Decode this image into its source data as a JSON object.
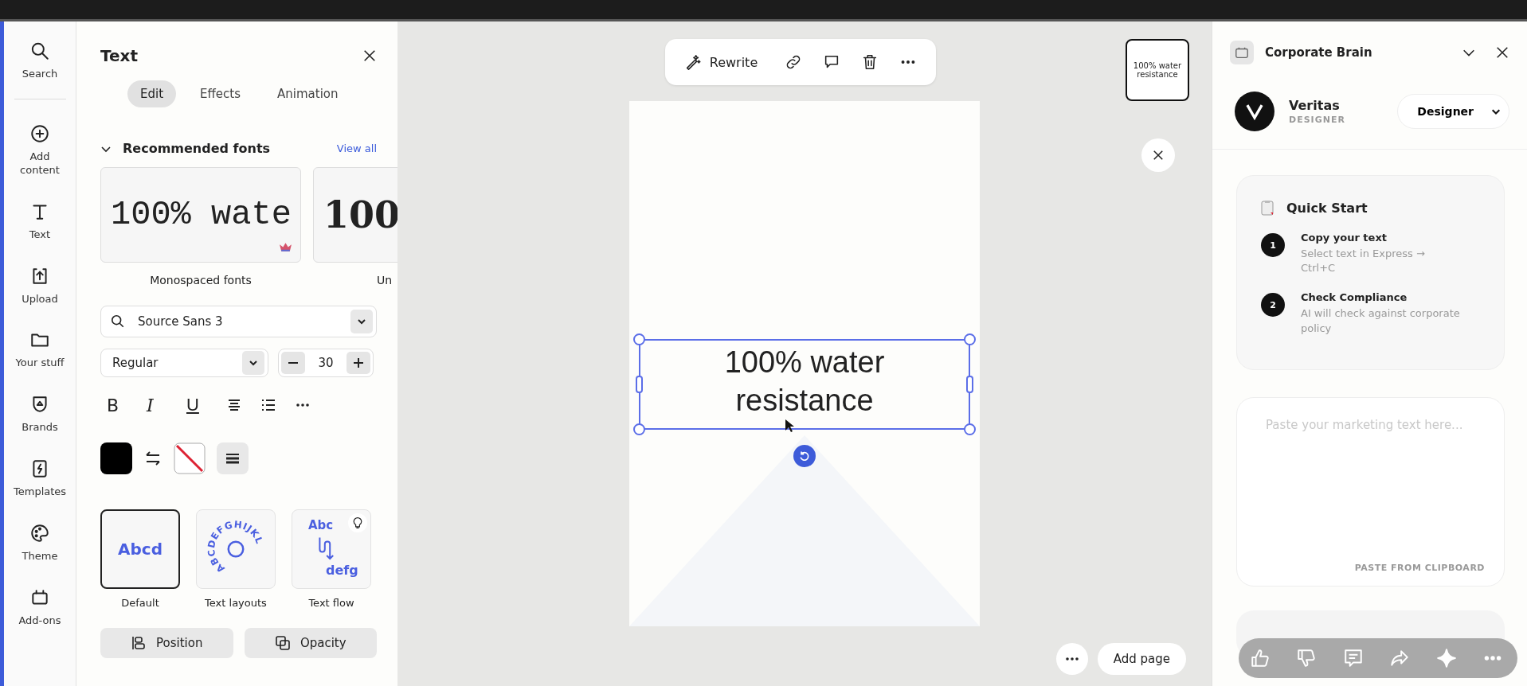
{
  "nav": [
    "Search",
    "Add content",
    "Text",
    "Upload",
    "Your stuff",
    "Brands",
    "Templates",
    "Theme",
    "Add-ons"
  ],
  "text_panel": {
    "title": "Text",
    "tabs": [
      {
        "label": "Edit",
        "selected": true
      },
      {
        "label": "Effects",
        "selected": false
      },
      {
        "label": "Animation",
        "selected": false
      }
    ],
    "recommended": {
      "title": "Recommended fonts",
      "link": "View all",
      "expanded": true,
      "fonts": [
        {
          "sample": "100% wate",
          "label": "Monospaced fonts",
          "kind": "mono",
          "premium": true
        },
        {
          "sample": "100",
          "label": "Un",
          "kind": "serif",
          "premium": false
        }
      ]
    },
    "font_field": "Source Sans 3",
    "weight": "Regular",
    "size": "30",
    "format": [
      {
        "kind": "bold",
        "glyph": "B"
      },
      {
        "kind": "italic",
        "glyph": "I"
      },
      {
        "kind": "underline",
        "glyph": "U"
      },
      {
        "kind": "align"
      },
      {
        "kind": "list"
      },
      {
        "kind": "more"
      }
    ],
    "styles": [
      {
        "kind": "default",
        "label": "Default",
        "sample": "Abcd",
        "selected": true
      },
      {
        "kind": "layouts",
        "label": "Text layouts",
        "sample": "ABCDEFGHIJKL",
        "selected": false
      },
      {
        "kind": "flow",
        "label": "Text flow",
        "sample": "Abc",
        "sample_2": "defg",
        "selected": false
      }
    ],
    "buttons": [
      "Position",
      "Opacity"
    ]
  },
  "canvas": {
    "rewrite": "Rewrite",
    "thumbnail": "100% water resistance",
    "text_box": "100% water resistance",
    "add_page": "Add page"
  },
  "right_panel": {
    "title": "Corporate Brain",
    "user": {
      "name": "Veritas",
      "role": "DESIGNER"
    },
    "role_select": "Designer",
    "quick_start": {
      "title": "Quick Start",
      "steps": [
        {
          "number": "1",
          "title": "Copy your text",
          "desc": "Select text in Express → Ctrl+C"
        },
        {
          "number": "2",
          "title": "Check Compliance",
          "desc": "AI will check against corporate policy"
        }
      ]
    },
    "input": {
      "placeholder": "Paste your marketing text here..."
    },
    "paste_button": "PASTE FROM CLIPBOARD"
  }
}
